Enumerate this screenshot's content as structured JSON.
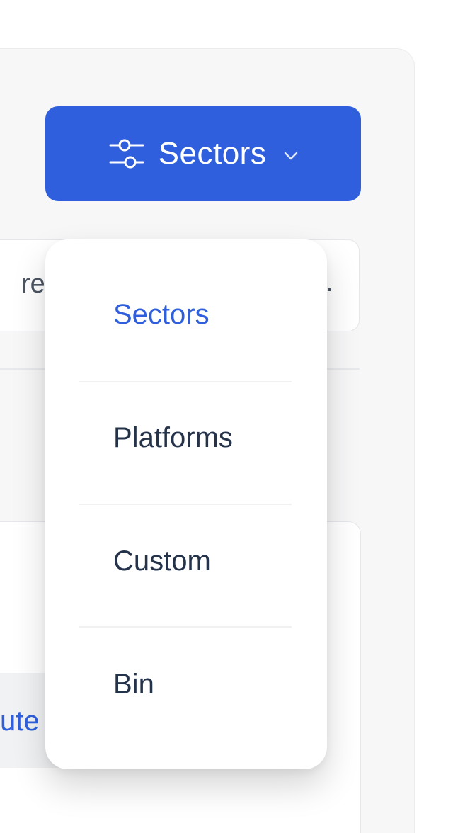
{
  "toolbar": {
    "sectors_button_label": "Sectors"
  },
  "search": {
    "visible_text_fragment": "rea",
    "trailing_fragment": "."
  },
  "content": {
    "link_fragment": "ute"
  },
  "dropdown": {
    "items": [
      {
        "label": "Sectors",
        "active": true
      },
      {
        "label": "Platforms",
        "active": false
      },
      {
        "label": "Custom",
        "active": false
      },
      {
        "label": "Bin",
        "active": false
      }
    ]
  },
  "colors": {
    "accent": "#2f5fdc",
    "menu_text": "#24324a",
    "background_panel": "#f7f7f8"
  },
  "icons": {
    "filter": "sliders-icon",
    "chevron": "chevron-down-icon"
  }
}
